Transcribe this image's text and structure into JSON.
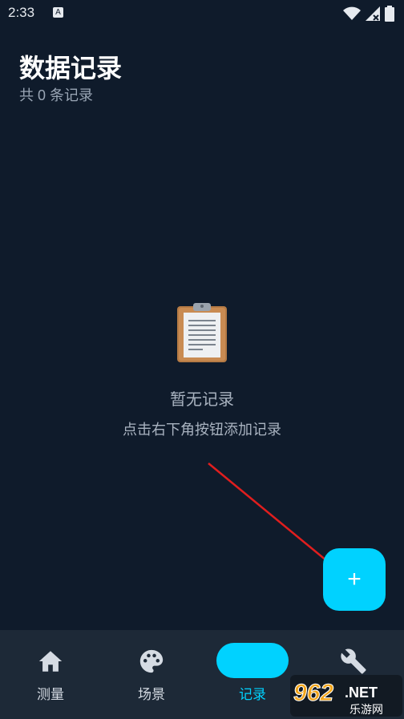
{
  "status_bar": {
    "time": "2:33",
    "notification_letter": "A"
  },
  "header": {
    "title": "数据记录",
    "subtitle": "共 0 条记录"
  },
  "empty_state": {
    "icon": "clipboard-icon",
    "title": "暂无记录",
    "hint": "点击右下角按钮添加记录"
  },
  "fab": {
    "label": "+",
    "color": "#00d2ff"
  },
  "bottom_nav": {
    "items": [
      {
        "label": "测量",
        "icon": "home-icon"
      },
      {
        "label": "场景",
        "icon": "palette-icon"
      },
      {
        "label": "记录",
        "icon": "",
        "active": true
      },
      {
        "label": "",
        "icon": "wrench-icon"
      }
    ]
  },
  "watermark": {
    "text_main": "962.NET",
    "text_sub": "乐游网"
  },
  "colors": {
    "background": "#0f1b2b",
    "accent": "#00d2ff",
    "nav_background": "#1d2937",
    "muted_text": "#a9b3c0",
    "arrow": "#e01e1e"
  }
}
